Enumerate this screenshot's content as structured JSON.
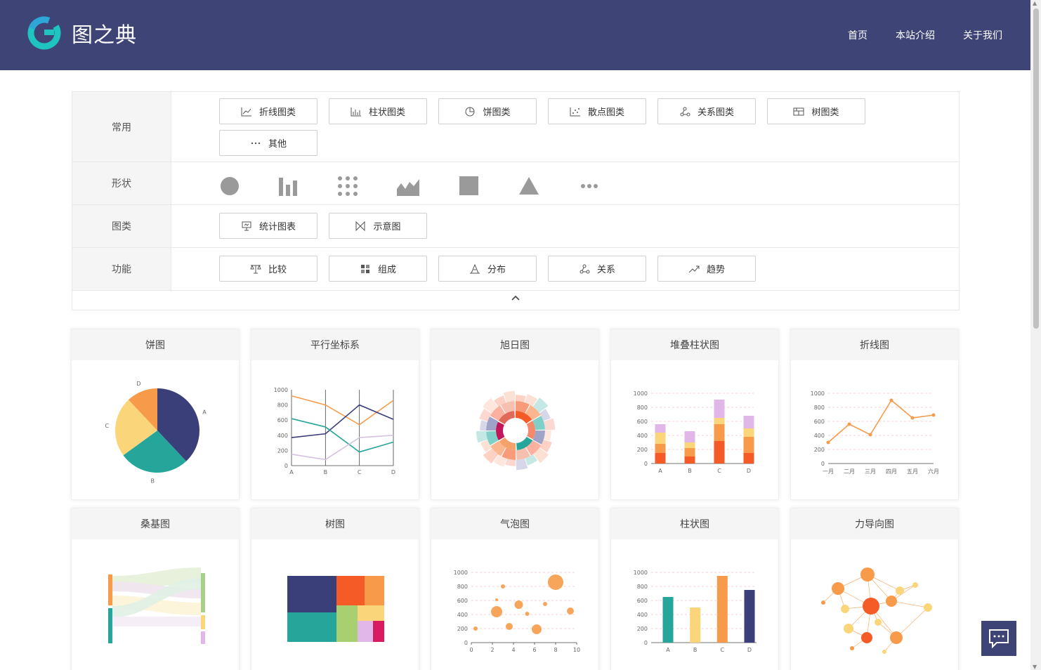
{
  "header": {
    "logo_text": "图之典",
    "nav": [
      "首页",
      "本站介绍",
      "关于我们"
    ]
  },
  "colors": {
    "header_bg": "#3f4477",
    "navy": "#3a3f7a",
    "teal": "#26a69a",
    "orange": "#f79b4a",
    "red_orange": "#f45b27",
    "yellow": "#fbd57a",
    "lavender": "#e0b7e8"
  },
  "filter": {
    "rows": [
      {
        "label": "常用",
        "buttons": [
          {
            "label": "折线图类",
            "icon": "line-chart-icon"
          },
          {
            "label": "柱状图类",
            "icon": "bar-chart-icon"
          },
          {
            "label": "饼图类",
            "icon": "pie-chart-icon"
          },
          {
            "label": "散点图类",
            "icon": "scatter-chart-icon"
          },
          {
            "label": "关系图类",
            "icon": "relation-chart-icon"
          },
          {
            "label": "树图类",
            "icon": "tree-chart-icon"
          },
          {
            "label": "其他",
            "icon": "more-icon"
          }
        ]
      },
      {
        "label": "形状",
        "shapes": [
          "circle-shape-icon",
          "bars-shape-icon",
          "dots-shape-icon",
          "area-shape-icon",
          "square-shape-icon",
          "triangle-shape-icon",
          "more-shape-icon"
        ]
      },
      {
        "label": "图类",
        "buttons": [
          {
            "label": "统计图表",
            "icon": "stat-chart-icon"
          },
          {
            "label": "示意图",
            "icon": "diagram-icon"
          }
        ]
      },
      {
        "label": "功能",
        "buttons": [
          {
            "label": "比较",
            "icon": "compare-icon"
          },
          {
            "label": "组成",
            "icon": "composition-icon"
          },
          {
            "label": "分布",
            "icon": "distribution-icon"
          },
          {
            "label": "关系",
            "icon": "relation-icon"
          },
          {
            "label": "趋势",
            "icon": "trend-icon"
          }
        ]
      }
    ]
  },
  "cards": [
    "饼图",
    "平行坐标系",
    "旭日图",
    "堆叠柱状图",
    "折线图",
    "桑基图",
    "树图",
    "气泡图",
    "柱状图",
    "力导向图"
  ],
  "chart_data": [
    {
      "type": "pie",
      "categories": [
        "A",
        "B",
        "C",
        "D"
      ],
      "values": [
        38,
        27,
        23,
        12
      ]
    },
    {
      "type": "line",
      "categories": [
        "A",
        "B",
        "C",
        "D"
      ],
      "ylim": [
        0,
        1000
      ],
      "yticks": [
        0,
        200,
        400,
        600,
        800,
        1000
      ],
      "series": [
        {
          "values": [
            920,
            800,
            540,
            860
          ]
        },
        {
          "values": [
            370,
            420,
            800,
            610
          ]
        },
        {
          "values": [
            620,
            510,
            180,
            310
          ]
        },
        {
          "values": [
            150,
            80,
            370,
            400
          ]
        }
      ]
    },
    {
      "type": "sunburst"
    },
    {
      "type": "bar",
      "categories": [
        "A",
        "B",
        "C",
        "D"
      ],
      "ylim": [
        0,
        1000
      ],
      "yticks": [
        0,
        200,
        400,
        600,
        800,
        1000
      ],
      "series": [
        {
          "values": [
            150,
            100,
            320,
            150
          ]
        },
        {
          "values": [
            130,
            120,
            240,
            230
          ]
        },
        {
          "values": [
            160,
            80,
            90,
            120
          ]
        },
        {
          "values": [
            120,
            160,
            260,
            180
          ]
        }
      ]
    },
    {
      "type": "line",
      "categories": [
        "一月",
        "二月",
        "三月",
        "四月",
        "五月",
        "六月"
      ],
      "ylim": [
        0,
        1000
      ],
      "yticks": [
        0,
        200,
        400,
        600,
        800,
        1000
      ],
      "series": [
        {
          "values": [
            300,
            560,
            410,
            900,
            650,
            690
          ]
        }
      ]
    },
    {
      "type": "sankey"
    },
    {
      "type": "treemap"
    },
    {
      "type": "scatter",
      "xlim": [
        0,
        10
      ],
      "ylim": [
        0,
        1000
      ],
      "xticks": [
        0,
        2,
        4,
        6,
        8,
        10
      ],
      "yticks": [
        0,
        200,
        400,
        600,
        800,
        1000
      ],
      "points": [
        {
          "x": 3,
          "y": 800,
          "r": 3
        },
        {
          "x": 8,
          "y": 860,
          "r": 11
        },
        {
          "x": 2.4,
          "y": 440,
          "r": 8
        },
        {
          "x": 4.5,
          "y": 540,
          "r": 6
        },
        {
          "x": 5.3,
          "y": 410,
          "r": 3
        },
        {
          "x": 7,
          "y": 550,
          "r": 3
        },
        {
          "x": 9.4,
          "y": 450,
          "r": 5
        },
        {
          "x": 3.6,
          "y": 230,
          "r": 5
        },
        {
          "x": 6.2,
          "y": 190,
          "r": 7
        },
        {
          "x": 0.4,
          "y": 200,
          "r": 3
        },
        {
          "x": 2.4,
          "y": 610,
          "r": 2
        }
      ]
    },
    {
      "type": "bar",
      "categories": [
        "A",
        "B",
        "C",
        "D"
      ],
      "ylim": [
        0,
        1000
      ],
      "yticks": [
        0,
        200,
        400,
        600,
        800,
        1000
      ],
      "values": [
        650,
        500,
        950,
        750
      ],
      "colors": [
        "#26a69a",
        "#fbd57a",
        "#f79b4a",
        "#3a3f7a"
      ]
    },
    {
      "type": "force"
    }
  ]
}
